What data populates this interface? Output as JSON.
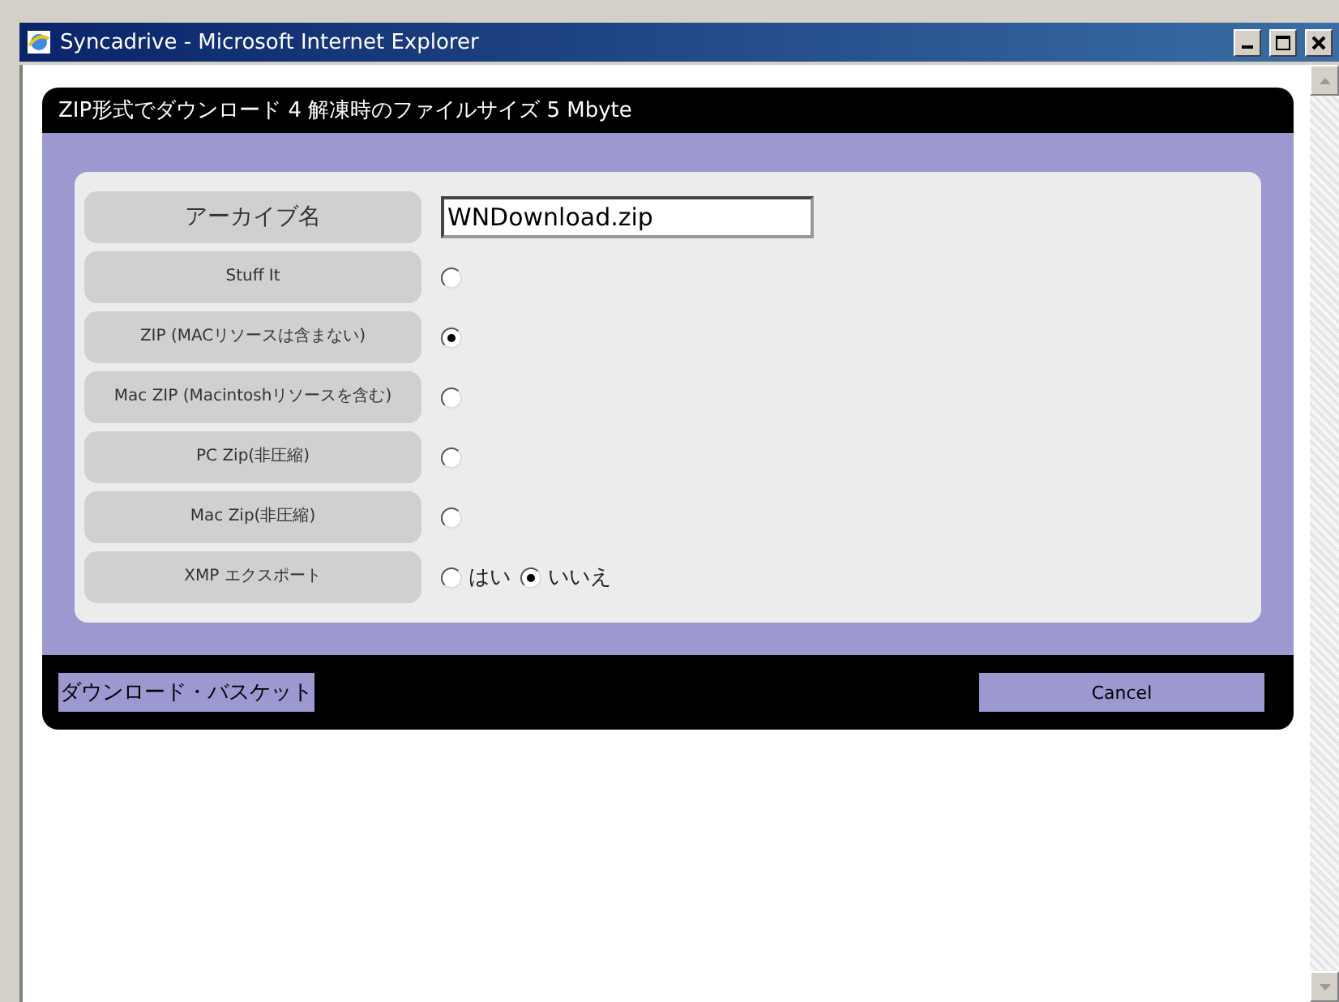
{
  "window": {
    "title": "Syncadrive - Microsoft Internet Explorer"
  },
  "header": {
    "title": "ZIP形式でダウンロード 4 解凍時のファイルサイズ 5 Mbyte"
  },
  "rows": [
    {
      "kind": "text",
      "label": "アーカイブ名",
      "value": "WNDownload.zip"
    },
    {
      "kind": "radio",
      "label": "Stuff It",
      "selected": false
    },
    {
      "kind": "radio",
      "label": "ZIP (MACリソースは含まない)",
      "selected": true
    },
    {
      "kind": "radio",
      "label": "Mac ZIP (Macintoshリソースを含む)",
      "selected": false
    },
    {
      "kind": "radio",
      "label": "PC Zip(非圧縮)",
      "selected": false
    },
    {
      "kind": "radio",
      "label": "Mac Zip(非圧縮)",
      "selected": false
    },
    {
      "kind": "choice",
      "label": "XMP エクスポート",
      "options": [
        {
          "label": "はい",
          "selected": false
        },
        {
          "label": "いいえ",
          "selected": true
        }
      ]
    }
  ],
  "footer": {
    "link": "ダウンロード・バスケット",
    "button": "Cancel"
  }
}
